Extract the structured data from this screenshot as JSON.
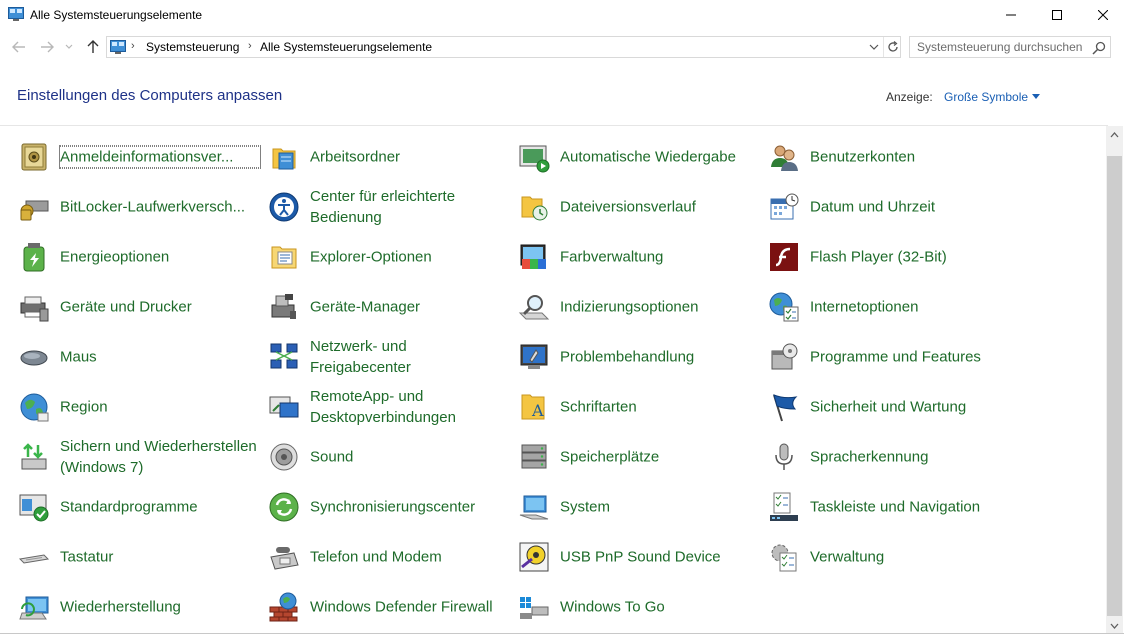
{
  "window": {
    "title": "Alle Systemsteuerungselemente"
  },
  "nav": {
    "breadcrumb": [
      "Systemsteuerung",
      "Alle Systemsteuerungselemente"
    ],
    "search_placeholder": "Systemsteuerung durchsuchen"
  },
  "header": {
    "title": "Einstellungen des Computers anpassen",
    "view_label": "Anzeige:",
    "view_value": "Große Symbole"
  },
  "colors": {
    "link_green": "#1e6b2a",
    "title_blue": "#1e3287",
    "accent_blue": "#1a5fb4"
  },
  "items": [
    {
      "label": "Anmeldeinformationsver...",
      "icon": "credential-vault-icon"
    },
    {
      "label": "Arbeitsordner",
      "icon": "work-folders-icon"
    },
    {
      "label": "Automatische Wiedergabe",
      "icon": "autoplay-icon"
    },
    {
      "label": "Benutzerkonten",
      "icon": "user-accounts-icon"
    },
    {
      "label": "BitLocker-Laufwerkversch...",
      "icon": "bitlocker-icon"
    },
    {
      "label": "Center für erleichterte Bedienung",
      "icon": "ease-of-access-icon"
    },
    {
      "label": "Dateiversionsverlauf",
      "icon": "file-history-icon"
    },
    {
      "label": "Datum und Uhrzeit",
      "icon": "date-time-icon"
    },
    {
      "label": "Energieoptionen",
      "icon": "power-options-icon"
    },
    {
      "label": "Explorer-Optionen",
      "icon": "explorer-options-icon"
    },
    {
      "label": "Farbverwaltung",
      "icon": "color-management-icon"
    },
    {
      "label": "Flash Player (32-Bit)",
      "icon": "flash-player-icon"
    },
    {
      "label": "Geräte und Drucker",
      "icon": "devices-printers-icon"
    },
    {
      "label": "Geräte-Manager",
      "icon": "device-manager-icon"
    },
    {
      "label": "Indizierungsoptionen",
      "icon": "indexing-options-icon"
    },
    {
      "label": "Internetoptionen",
      "icon": "internet-options-icon"
    },
    {
      "label": "Maus",
      "icon": "mouse-icon"
    },
    {
      "label": "Netzwerk- und Freigabecenter",
      "icon": "network-sharing-icon"
    },
    {
      "label": "Problembehandlung",
      "icon": "troubleshooting-icon"
    },
    {
      "label": "Programme und Features",
      "icon": "programs-features-icon"
    },
    {
      "label": "Region",
      "icon": "region-globe-icon"
    },
    {
      "label": "RemoteApp- und Desktopverbindungen",
      "icon": "remoteapp-icon"
    },
    {
      "label": "Schriftarten",
      "icon": "fonts-icon"
    },
    {
      "label": "Sicherheit und Wartung",
      "icon": "security-maintenance-flag-icon"
    },
    {
      "label": "Sichern und Wiederherstellen (Windows 7)",
      "icon": "backup-restore-icon"
    },
    {
      "label": "Sound",
      "icon": "sound-speaker-icon"
    },
    {
      "label": "Speicherplätze",
      "icon": "storage-spaces-icon"
    },
    {
      "label": "Spracherkennung",
      "icon": "microphone-icon"
    },
    {
      "label": "Standardprogramme",
      "icon": "default-programs-icon"
    },
    {
      "label": "Synchronisierungscenter",
      "icon": "sync-center-icon"
    },
    {
      "label": "System",
      "icon": "system-monitor-icon"
    },
    {
      "label": "Taskleiste und Navigation",
      "icon": "taskbar-icon"
    },
    {
      "label": "Tastatur",
      "icon": "keyboard-icon"
    },
    {
      "label": "Telefon und Modem",
      "icon": "phone-modem-icon"
    },
    {
      "label": "USB PnP Sound Device",
      "icon": "usb-sound-device-icon"
    },
    {
      "label": "Verwaltung",
      "icon": "administrative-tools-icon"
    },
    {
      "label": "Wiederherstellung",
      "icon": "recovery-icon"
    },
    {
      "label": "Windows Defender Firewall",
      "icon": "firewall-icon"
    },
    {
      "label": "Windows To Go",
      "icon": "windows-to-go-icon"
    }
  ]
}
